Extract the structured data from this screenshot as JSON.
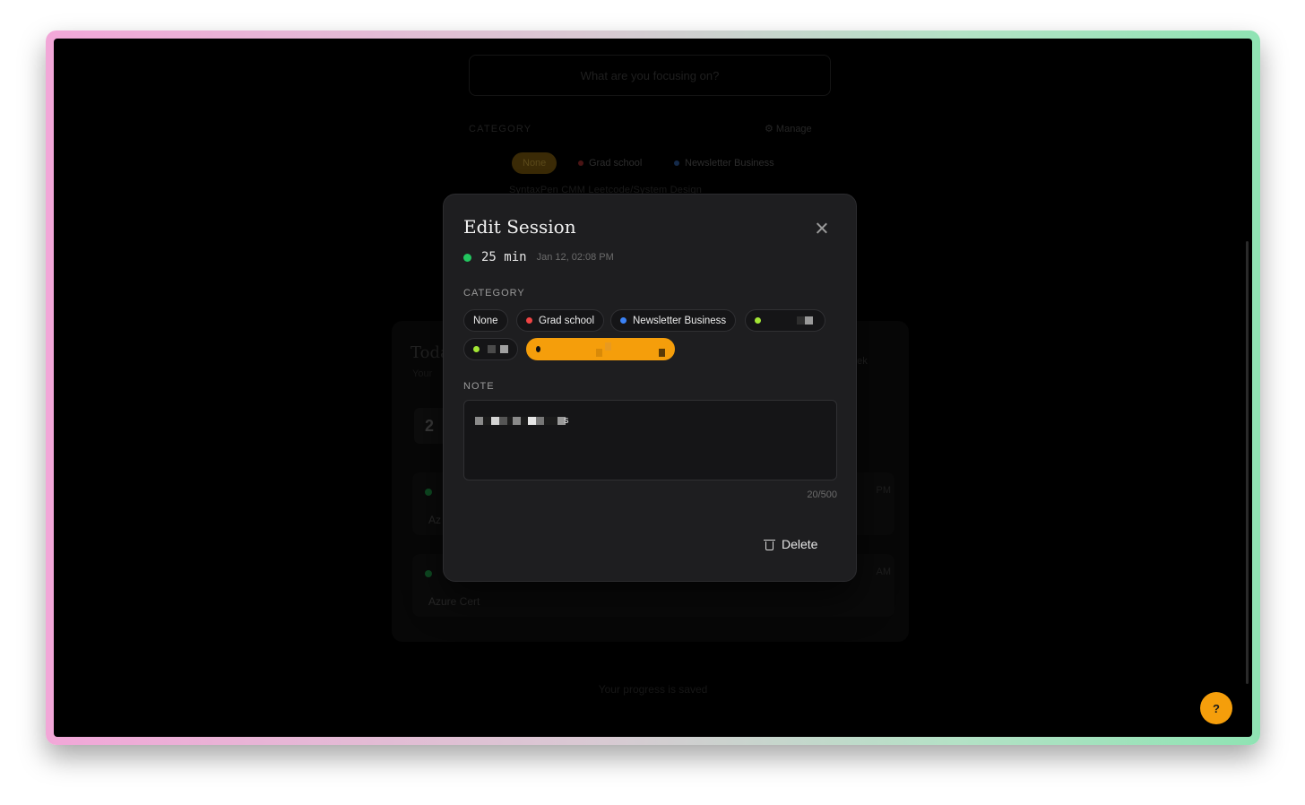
{
  "background": {
    "focus_placeholder": "What are you focusing on?",
    "category_label": "CATEGORY",
    "manage_label": "⚙ Manage",
    "chips": [
      {
        "label": "None"
      },
      {
        "label": "Grad school",
        "color": "#4a1414"
      },
      {
        "label": "Newsletter Business",
        "color": "#142a4a"
      }
    ],
    "chips_row2": "SyntaxPen      CMM      Leetcode/System Design",
    "today_title": "Toda",
    "today_sub": "Your",
    "stat_value": "2",
    "week_label": "eek",
    "sessions": [
      {
        "name": "Az",
        "time": "PM"
      },
      {
        "name": "Azure Cert",
        "time": "AM"
      }
    ],
    "saved_text": "Your progress is saved"
  },
  "modal": {
    "title": "Edit Session",
    "duration": "25 min",
    "datetime": "Jan 12, 02:08 PM",
    "category_label": "CATEGORY",
    "categories": [
      {
        "label": "None",
        "color": "",
        "selected": false
      },
      {
        "label": "Grad school",
        "color": "#ef4444",
        "selected": false
      },
      {
        "label": "Newsletter Business",
        "color": "#3b82f6",
        "selected": false
      },
      {
        "label": "",
        "color": "#a3e635",
        "selected": false
      },
      {
        "label": "",
        "color": "#a3e635",
        "selected": false
      },
      {
        "label": "",
        "color": "#111111",
        "selected": true
      }
    ],
    "note_label": "NOTE",
    "note_visible_text": "s",
    "counter": "20/500",
    "delete_label": "Delete"
  },
  "help_label": "?",
  "colors": {
    "accent": "#f59e0b",
    "status_green": "#22c55e"
  }
}
